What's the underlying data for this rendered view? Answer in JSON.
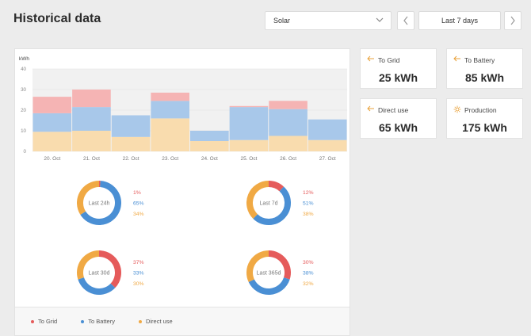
{
  "header": {
    "title": "Historical data"
  },
  "controls": {
    "source": "Solar",
    "range": "Last 7 days"
  },
  "stats": [
    {
      "label": "To Grid",
      "value": "25 kWh",
      "icon": "arrow-left-icon"
    },
    {
      "label": "To Battery",
      "value": "85 kWh",
      "icon": "arrow-left-icon"
    },
    {
      "label": "Direct use",
      "value": "65 kWh",
      "icon": "arrow-left-icon"
    },
    {
      "label": "Production",
      "value": "175 kWh",
      "icon": "sun-icon"
    }
  ],
  "colors": {
    "grid": "#f5b4b4",
    "battery": "#a8c8ea",
    "direct": "#f9dcae",
    "grid_dot": "#e55b5b",
    "battery_dot": "#4a8fd4",
    "direct_dot": "#f0a944",
    "accent": "#e9a23b"
  },
  "chart_data": {
    "type": "bar",
    "ylabel": "kWh",
    "ylim": [
      0,
      40
    ],
    "yticks": [
      0,
      10,
      20,
      30,
      40
    ],
    "categories": [
      "20. Oct",
      "21. Oct",
      "22. Oct",
      "23. Oct",
      "24. Oct",
      "25. Oct",
      "26. Oct",
      "27. Oct"
    ],
    "series": [
      {
        "name": "Direct use",
        "values": [
          9.5,
          10,
          7,
          16,
          5,
          5.5,
          7.5,
          5.5
        ]
      },
      {
        "name": "To Battery",
        "values": [
          9,
          11.5,
          10.5,
          8.5,
          5,
          16,
          13,
          10
        ]
      },
      {
        "name": "To Grid",
        "values": [
          8,
          8.5,
          0,
          4,
          0,
          0.5,
          4,
          0
        ]
      }
    ]
  },
  "donuts": [
    {
      "label": "Last 24h",
      "grid": 1,
      "battery": 65,
      "direct": 34,
      "grid_text": "1%",
      "battery_text": "65%",
      "direct_text": "34%"
    },
    {
      "label": "Last 7d",
      "grid": 12,
      "battery": 51,
      "direct": 38,
      "grid_text": "12%",
      "battery_text": "51%",
      "direct_text": "38%"
    },
    {
      "label": "Last 30d",
      "grid": 37,
      "battery": 33,
      "direct": 30,
      "grid_text": "37%",
      "battery_text": "33%",
      "direct_text": "30%"
    },
    {
      "label": "Last 365d",
      "grid": 30,
      "battery": 38,
      "direct": 32,
      "grid_text": "30%",
      "battery_text": "38%",
      "direct_text": "32%"
    }
  ],
  "legend": {
    "grid": "To Grid",
    "battery": "To Battery",
    "direct": "Direct use"
  }
}
